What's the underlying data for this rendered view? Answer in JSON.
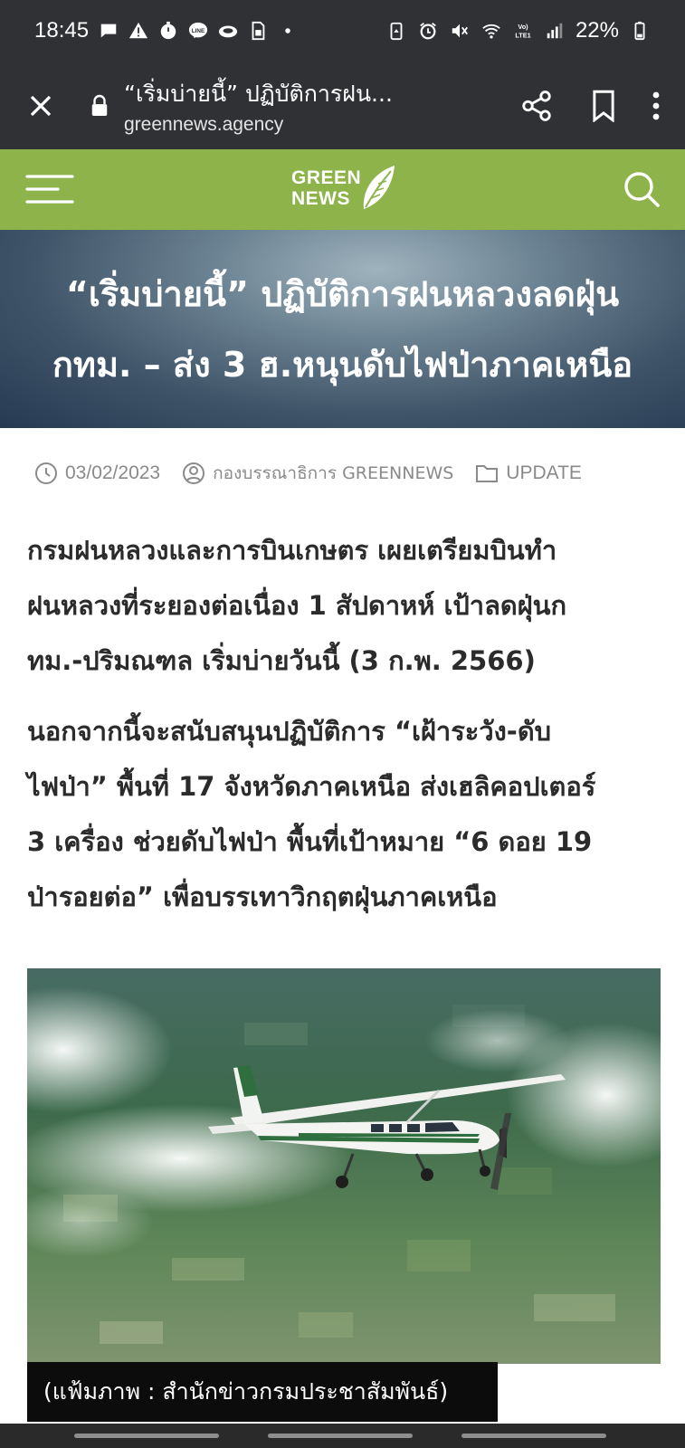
{
  "status_bar": {
    "time": "18:45",
    "battery_percent": "22%",
    "left_icons": [
      "message-icon",
      "warning-icon",
      "timer-icon",
      "line-icon",
      "cloud-icon",
      "sim-icon",
      "dot-icon"
    ],
    "right_icons": [
      "battery-saver-icon",
      "alarm-icon",
      "mute-icon",
      "wifi-icon",
      "volte-icon",
      "signal-icon",
      "battery-icon"
    ]
  },
  "browser": {
    "page_title": "“เริ่มบ่ายนี้” ปฏิบัติการฝน...",
    "domain": "greennews.agency",
    "actions": [
      "share-icon",
      "bookmark-icon",
      "more-icon"
    ]
  },
  "site": {
    "logo_line1": "GREEN",
    "logo_line2": "NEWS",
    "header_color": "#8db34a"
  },
  "article": {
    "title_line1": "“เริ่มบ่ายนี้” ปฏิบัติการฝนหลวงลดฝุ่น",
    "title_line2": "กทม. – ส่ง 3 ฮ.หนุนดับไฟป่าภาคเหนือ",
    "date": "03/02/2023",
    "author": "กองบรรณาธิการ GREENNEWS",
    "category": "UPDATE",
    "paragraph1": [
      "กรมฝนหลวงและการบินเกษตร เผยเตรียมบินทำ",
      "ฝนหลวงที่ระยองต่อเนื่อง 1 สัปดาหห์ เป้าลดฝุ่นก",
      "ทม.-ปริมณฑล เริ่มบ่ายวันนี้ (3 ก.พ. 2566)"
    ],
    "paragraph2": [
      "นอกจากนี้จะสนับสนุนปฏิบัติการ “เฝ้าระวัง-ดับ",
      "ไฟป่า” พื้นที่ 17 จังหวัดภาคเหนือ ส่งเฮลิคอปเตอร์",
      "3 เครื่อง ช่วยดับไฟป่า พื้นที่เป้าหมาย “6 ดอย 19",
      "ป่ารอยต่อ” เพื่อบรรเทาวิกฤตฝุ่นภาคเหนือ"
    ],
    "photo_caption": "(แฟ้มภาพ : สำนักข่าวกรมประชาสัมพันธ์)"
  }
}
